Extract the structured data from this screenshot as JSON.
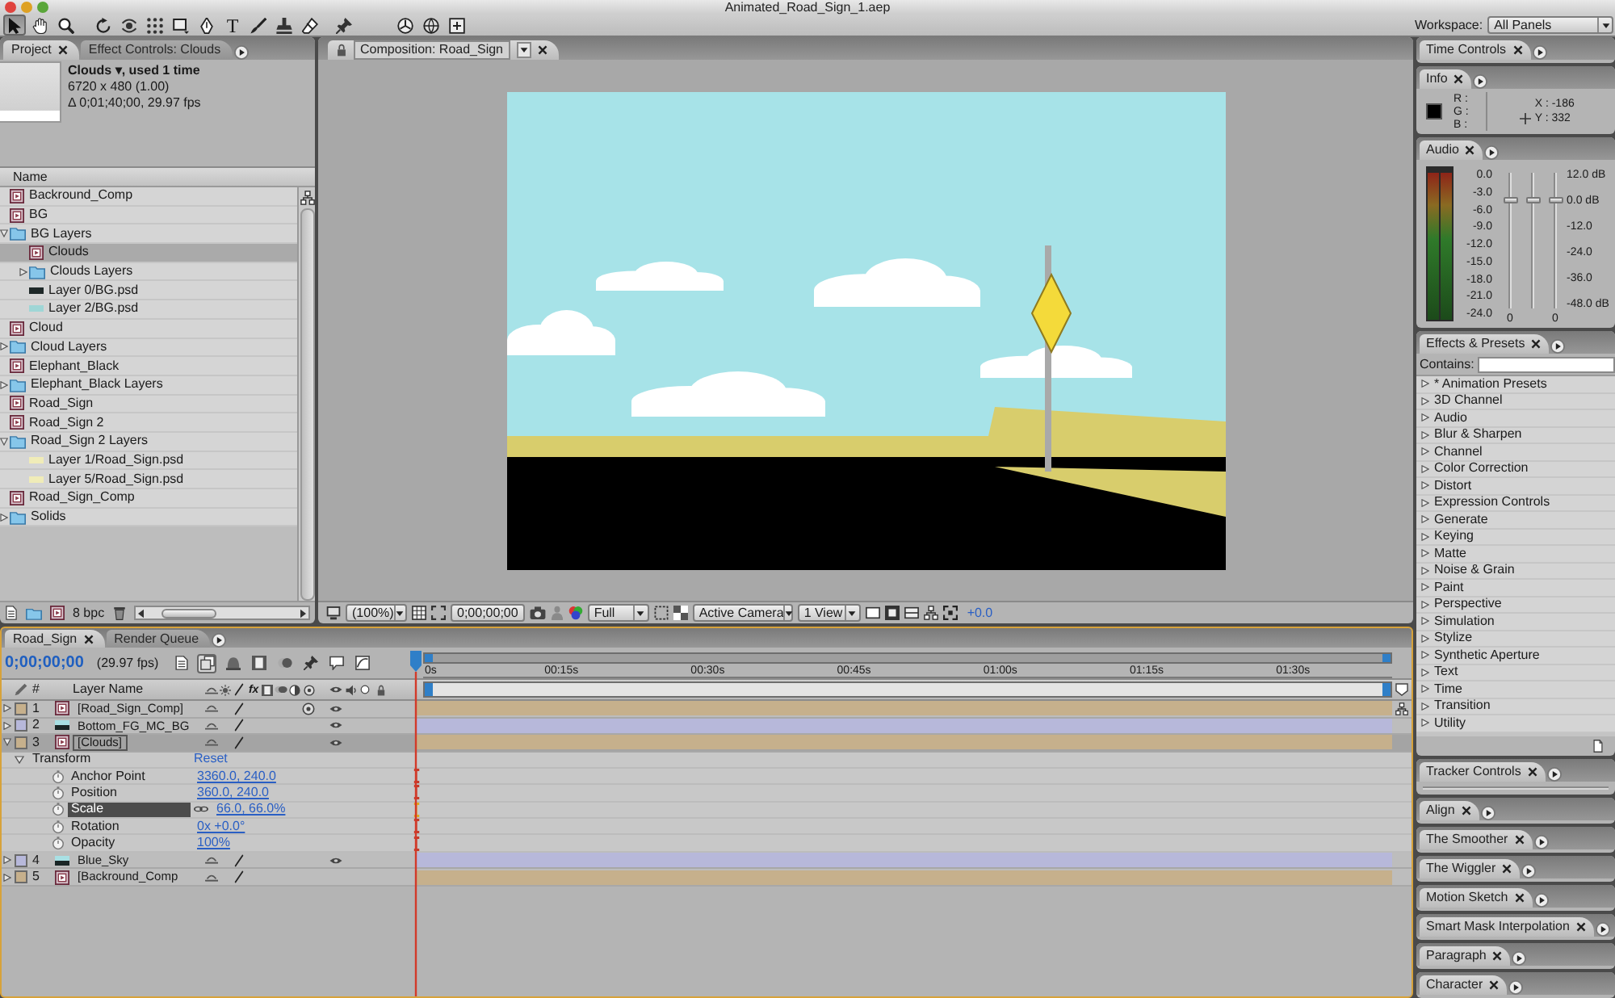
{
  "window": {
    "title": "Animated_Road_Sign_1.aep"
  },
  "toolbar": {
    "tools": [
      {
        "kind": "select",
        "selected": true
      },
      {
        "kind": "hand",
        "selected": false
      },
      {
        "kind": "zoom",
        "selected": false
      },
      {
        "kind": "rotate",
        "selected": false
      },
      {
        "kind": "orbit",
        "selected": false
      },
      {
        "kind": "pan",
        "selected": false
      },
      {
        "kind": "rectangle",
        "selected": false
      },
      {
        "kind": "pen",
        "selected": false
      },
      {
        "kind": "text",
        "glyph": "T",
        "selected": false
      },
      {
        "kind": "brush",
        "selected": false
      },
      {
        "kind": "stamp",
        "selected": false
      },
      {
        "kind": "eraser",
        "selected": false
      },
      {
        "kind": "pin",
        "selected": false
      },
      {
        "kind": "local-axis",
        "selected": false
      },
      {
        "kind": "world-axis",
        "selected": false
      },
      {
        "kind": "view-axis",
        "selected": false
      }
    ],
    "workspace_label": "Workspace:",
    "workspace": "All Panels"
  },
  "project": {
    "tabs": [
      {
        "label": "Project",
        "selected": true,
        "closable": true
      },
      {
        "label": "Effect Controls: Clouds",
        "selected": false,
        "closable": false
      }
    ],
    "info": [
      "Clouds ▾, used 1 time",
      "6720 x 480 (1.00)",
      "Δ 0;01;40;00, 29.97 fps"
    ],
    "column": "Name",
    "items": [
      {
        "name": "Backround_Comp",
        "kind": "comp",
        "selected": false,
        "expanded": false
      },
      {
        "name": "BG",
        "kind": "comp",
        "selected": false,
        "expanded": false
      },
      {
        "name": "BG Layers",
        "kind": "folder",
        "selected": false,
        "expanded": true,
        "children": [
          {
            "name": "Clouds",
            "kind": "comp",
            "selected": true,
            "expanded": false
          },
          {
            "name": "Clouds Layers",
            "kind": "folder",
            "selected": false,
            "expanded": false
          },
          {
            "name": "Layer 0/BG.psd",
            "kind": "footage",
            "color": "#1e2828",
            "selected": false,
            "expanded": false
          },
          {
            "name": "Layer 2/BG.psd",
            "kind": "footage",
            "color": "#9fd6d6",
            "selected": false,
            "expanded": false
          }
        ]
      },
      {
        "name": "Cloud",
        "kind": "comp",
        "selected": false,
        "expanded": false
      },
      {
        "name": "Cloud Layers",
        "kind": "folder",
        "selected": false,
        "expanded": false
      },
      {
        "name": "Elephant_Black",
        "kind": "comp",
        "selected": false,
        "expanded": false
      },
      {
        "name": "Elephant_Black Layers",
        "kind": "folder",
        "selected": false,
        "expanded": false
      },
      {
        "name": "Road_Sign",
        "kind": "comp",
        "selected": false,
        "expanded": false
      },
      {
        "name": "Road_Sign 2",
        "kind": "comp",
        "selected": false,
        "expanded": false
      },
      {
        "name": "Road_Sign 2 Layers",
        "kind": "folder",
        "selected": false,
        "expanded": true,
        "children": [
          {
            "name": "Layer 1/Road_Sign.psd",
            "kind": "footage",
            "color": "#f0ecb8",
            "selected": false,
            "expanded": false
          },
          {
            "name": "Layer 5/Road_Sign.psd",
            "kind": "footage",
            "color": "#f0ecb8",
            "selected": false,
            "expanded": false
          }
        ]
      },
      {
        "name": "Road_Sign_Comp",
        "kind": "comp",
        "selected": false,
        "expanded": false
      },
      {
        "name": "Solids",
        "kind": "folder",
        "selected": false,
        "expanded": false
      }
    ],
    "bit_depth": "8 bpc"
  },
  "composition": {
    "tab": {
      "label": "Composition: Road_Sign",
      "selected": true,
      "closable": true
    },
    "footer": {
      "magnification": "(100%)",
      "timecode": "0;00;00;00",
      "resolution": "Full",
      "view": "Active Camera",
      "layout": "1 View",
      "exposure": "+0.0"
    }
  },
  "timeline": {
    "tabs": [
      {
        "label": "Road_Sign",
        "selected": true,
        "closable": true
      },
      {
        "label": "Render Queue",
        "selected": false,
        "closable": false
      }
    ],
    "timecode": "0;00;00;00",
    "frame_rate": "(29.97 fps)",
    "buttons": [
      {
        "kind": "document",
        "on": false
      },
      {
        "kind": "stack",
        "on": true
      },
      {
        "kind": "dome",
        "on": false
      },
      {
        "kind": "film",
        "on": false
      },
      {
        "kind": "blur",
        "on": false
      },
      {
        "kind": "pushpin",
        "on": false
      },
      {
        "kind": "bubble",
        "on": false
      },
      {
        "kind": "graph",
        "on": false
      }
    ],
    "columns": {
      "number": "#",
      "name": "Layer Name",
      "effects": "fx"
    },
    "ruler": [
      "0s",
      "00:15s",
      "00:30s",
      "00:45s",
      "01:00s",
      "01:15s",
      "01:30s"
    ],
    "layers": [
      {
        "number": "1",
        "name": "[Road_Sign_Comp]",
        "kind": "comp",
        "color": "#c6b08c",
        "selected": false,
        "expanded": false,
        "visible": true,
        "three_d": true
      },
      {
        "number": "2",
        "name": "Bottom_FG_MC_BG",
        "kind": "footage",
        "color": "#b7b8da",
        "selected": false,
        "expanded": false,
        "visible": true,
        "three_d": false
      },
      {
        "number": "3",
        "name": "[Clouds]",
        "kind": "comp",
        "color": "#c6b08c",
        "selected": true,
        "expanded": true,
        "visible": true,
        "three_d": false,
        "transform": {
          "label": "Transform",
          "reset": "Reset",
          "expanded": true,
          "properties": [
            {
              "name": "Anchor Point",
              "value": "3360.0, 240.0",
              "selected": false,
              "linked": false
            },
            {
              "name": "Position",
              "value": "360.0, 240.0",
              "selected": false,
              "linked": false
            },
            {
              "name": "Scale",
              "value": "66.0, 66.0%",
              "selected": true,
              "linked": true
            },
            {
              "name": "Rotation",
              "value": "0x +0.0°",
              "selected": false,
              "linked": false
            },
            {
              "name": "Opacity",
              "value": "100%",
              "selected": false,
              "linked": false
            }
          ]
        }
      },
      {
        "number": "4",
        "name": "Blue_Sky",
        "kind": "footage",
        "color": "#b7b8da",
        "selected": false,
        "expanded": false,
        "visible": true,
        "three_d": false
      },
      {
        "number": "5",
        "name": "[Backround_Comp",
        "kind": "comp",
        "color": "#c6b08c",
        "selected": false,
        "expanded": false,
        "visible": false,
        "three_d": false
      }
    ]
  },
  "panels": [
    {
      "kind": "collapsed",
      "title": "Time Controls"
    },
    {
      "kind": "info",
      "title": "Info",
      "channels": [
        "R :",
        "G :",
        "B :"
      ],
      "x": "X : -186",
      "y": "Y : 332"
    },
    {
      "kind": "audio",
      "title": "Audio",
      "meter_scale": [
        "0.0",
        "-3.0",
        "-6.0",
        "-9.0",
        "-12.0",
        "-15.0",
        "-18.0",
        "-21.0",
        "-24.0"
      ],
      "sliders": [
        {
          "level": 0.8,
          "reading": "0"
        },
        {
          "level": 0.8
        },
        {
          "level": 0.8,
          "reading": "0"
        }
      ],
      "db_scale": [
        "12.0 dB",
        "0.0 dB",
        "-12.0",
        "-24.0",
        "-36.0",
        "-48.0 dB"
      ]
    },
    {
      "kind": "effects",
      "title": "Effects & Presets",
      "search_label": "Contains:",
      "categories": [
        {
          "name": "* Animation Presets",
          "expanded": false
        },
        {
          "name": "3D Channel",
          "expanded": false
        },
        {
          "name": "Audio",
          "expanded": false
        },
        {
          "name": "Blur & Sharpen",
          "expanded": false
        },
        {
          "name": "Channel",
          "expanded": false
        },
        {
          "name": "Color Correction",
          "expanded": false
        },
        {
          "name": "Distort",
          "expanded": false
        },
        {
          "name": "Expression Controls",
          "expanded": false
        },
        {
          "name": "Generate",
          "expanded": false
        },
        {
          "name": "Keying",
          "expanded": false
        },
        {
          "name": "Matte",
          "expanded": false
        },
        {
          "name": "Noise & Grain",
          "expanded": false
        },
        {
          "name": "Paint",
          "expanded": false
        },
        {
          "name": "Perspective",
          "expanded": false
        },
        {
          "name": "Simulation",
          "expanded": false
        },
        {
          "name": "Stylize",
          "expanded": false
        },
        {
          "name": "Synthetic Aperture",
          "expanded": false
        },
        {
          "name": "Text",
          "expanded": false
        },
        {
          "name": "Time",
          "expanded": false
        },
        {
          "name": "Transition",
          "expanded": false
        },
        {
          "name": "Utility",
          "expanded": false
        }
      ]
    },
    {
      "kind": "tracker",
      "title": "Tracker Controls"
    },
    {
      "kind": "collapsed",
      "title": "Align"
    },
    {
      "kind": "collapsed",
      "title": "The Smoother"
    },
    {
      "kind": "collapsed",
      "title": "The Wiggler"
    },
    {
      "kind": "collapsed",
      "title": "Motion Sketch"
    },
    {
      "kind": "collapsed",
      "title": "Smart Mask Interpolation"
    },
    {
      "kind": "collapsed",
      "title": "Paragraph"
    },
    {
      "kind": "collapsed",
      "title": "Character"
    }
  ]
}
